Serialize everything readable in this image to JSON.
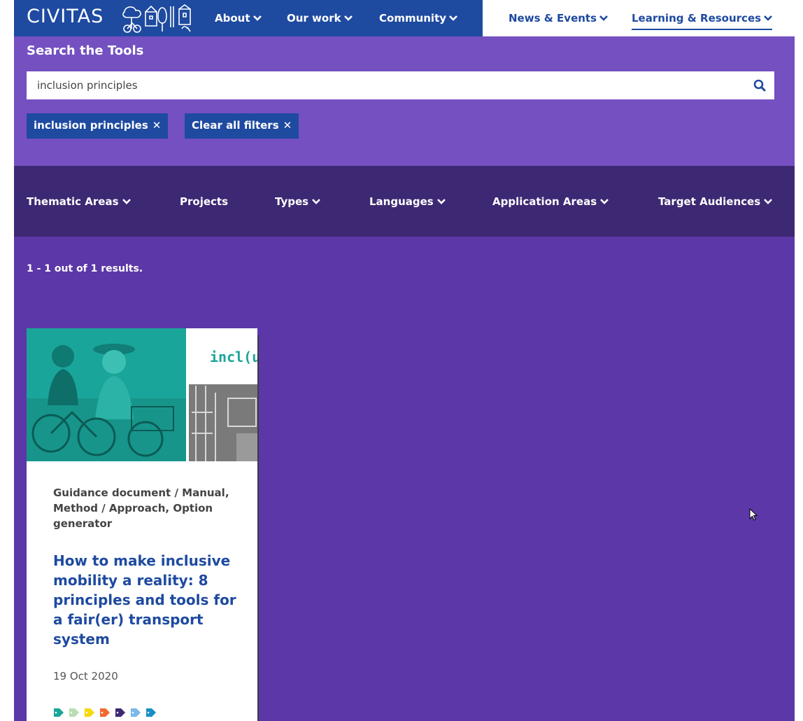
{
  "header": {
    "logo_text": "CIVITAS",
    "nav_left": [
      {
        "label": "About"
      },
      {
        "label": "Our work"
      },
      {
        "label": "Community"
      }
    ],
    "nav_right": [
      {
        "label": "News & Events"
      },
      {
        "label": "Learning & Resources",
        "active": true
      }
    ]
  },
  "search": {
    "title": "Search the Tools",
    "value": "inclusion principles",
    "chips": [
      {
        "label": "inclusion principles"
      },
      {
        "label": "Clear all filters"
      }
    ]
  },
  "filters": [
    {
      "label": "Thematic Areas",
      "dropdown": true
    },
    {
      "label": "Projects",
      "dropdown": false
    },
    {
      "label": "Types",
      "dropdown": true
    },
    {
      "label": "Languages",
      "dropdown": true
    },
    {
      "label": "Application Areas",
      "dropdown": true
    },
    {
      "label": "Target Audiences",
      "dropdown": true
    }
  ],
  "results": {
    "count_text": "1 - 1 out of 1 results.",
    "cards": [
      {
        "image_text": "incl(us",
        "meta": "Guidance document / Manual, Method / Approach, Option generator",
        "title": "How to make inclusive mobility a reality: 8 principles and tools for a fair(er) transport system",
        "date": "19 Oct 2020",
        "tag_colors": [
          "#1aa59a",
          "#b9dcb4",
          "#f5d90a",
          "#f26a2e",
          "#3d2873",
          "#7bb8e8",
          "#1a8fc4"
        ]
      }
    ]
  },
  "colors": {
    "brand_blue": "#1e4aa0",
    "search_purple": "#7450c1",
    "filter_purple": "#3d2873",
    "results_purple": "#5c37a8"
  }
}
